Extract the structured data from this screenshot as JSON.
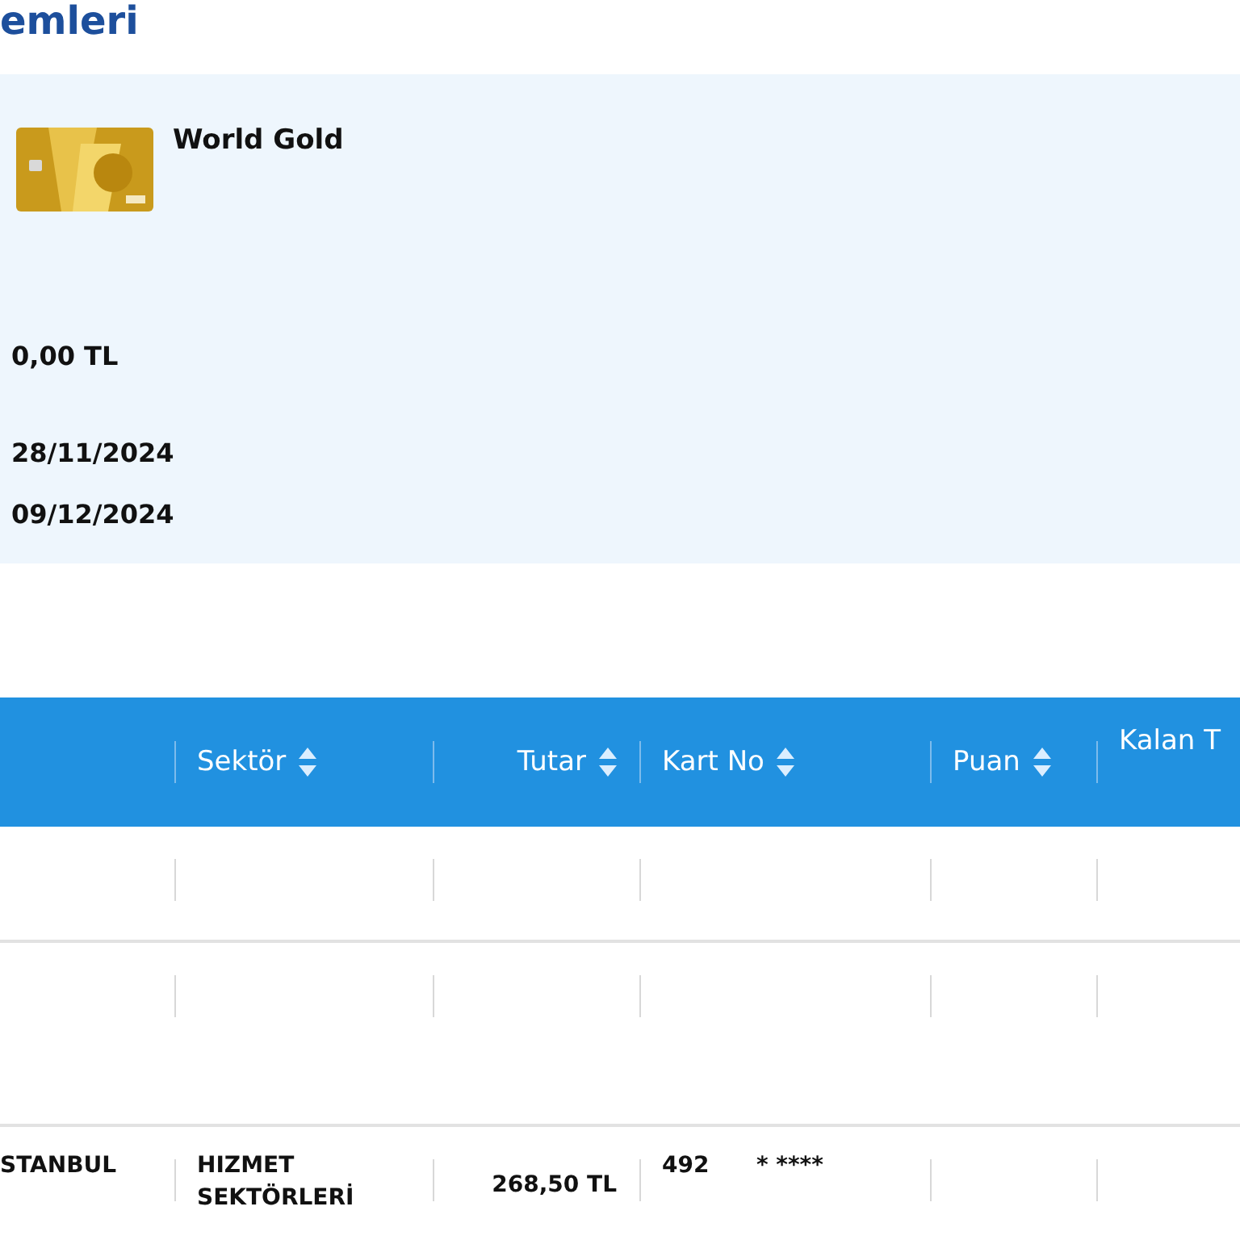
{
  "page": {
    "title": "emleri"
  },
  "card_panel": {
    "card_name": "World Gold",
    "amount": "0,00 TL",
    "dates": [
      "28/11/2024",
      "09/12/2024"
    ]
  },
  "table": {
    "columns": [
      {
        "kind": "blank"
      },
      {
        "label": "Sektör",
        "kind": "sortable"
      },
      {
        "label": "Tutar",
        "kind": "sortable"
      },
      {
        "label": "Kart No",
        "kind": "sortable"
      },
      {
        "label": "Puan",
        "kind": "sortable"
      },
      {
        "label": "Kalan T",
        "kind": "plain"
      }
    ],
    "rows": [
      {
        "cells": [
          "STANBUL",
          "HIZMET SEKTÖRLERİ",
          "268,50 TL",
          "492      * ****"
        ]
      }
    ]
  }
}
